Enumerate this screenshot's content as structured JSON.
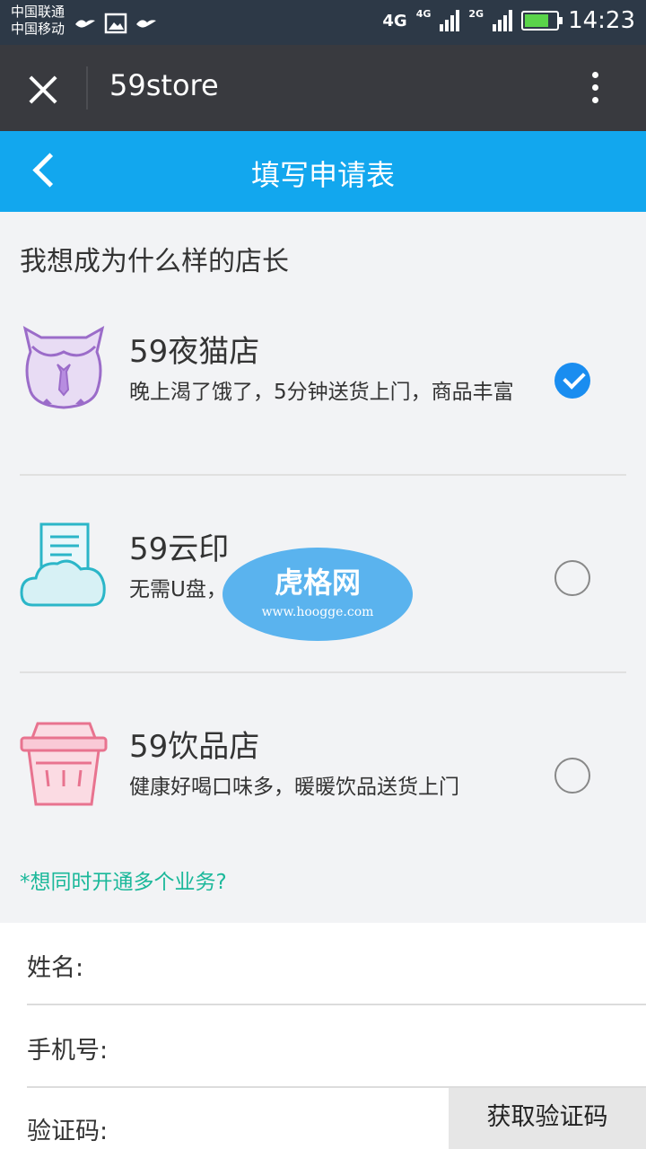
{
  "status_bar": {
    "carrier_1": "中国联通",
    "carrier_2": "中国移动",
    "network_1": "4G",
    "network_1_small": "4G",
    "network_2_small": "2G",
    "time": "14:23"
  },
  "wechat_bar": {
    "title": "59store"
  },
  "header": {
    "title": "填写申请表"
  },
  "section": {
    "title": "我想成为什么样的店长"
  },
  "options": [
    {
      "name": "59夜猫店",
      "desc": "晚上渴了饿了，5分钟送货上门，商品丰富",
      "selected": true,
      "icon": "owl-icon"
    },
    {
      "name": "59云印",
      "desc": "无需U盘，...彩印，照片打印",
      "selected": false,
      "icon": "cloud-document-icon"
    },
    {
      "name": "59饮品店",
      "desc": "健康好喝口味多，暖暖饮品送货上门",
      "selected": false,
      "icon": "drink-cup-icon"
    }
  ],
  "multi_link": "*想同时开通多个业务?",
  "form": {
    "name_label": "姓名:",
    "phone_label": "手机号:",
    "code_label": "验证码:",
    "sms_button": "获取验证码"
  },
  "watermark": {
    "text": "虎格网",
    "url": "www.hoogge.com"
  },
  "colors": {
    "status_bar": "#2d3947",
    "wechat_bar": "#393a3f",
    "header": "#12a7ee",
    "radio_checked": "#1a8df0",
    "link": "#1bb89a"
  }
}
